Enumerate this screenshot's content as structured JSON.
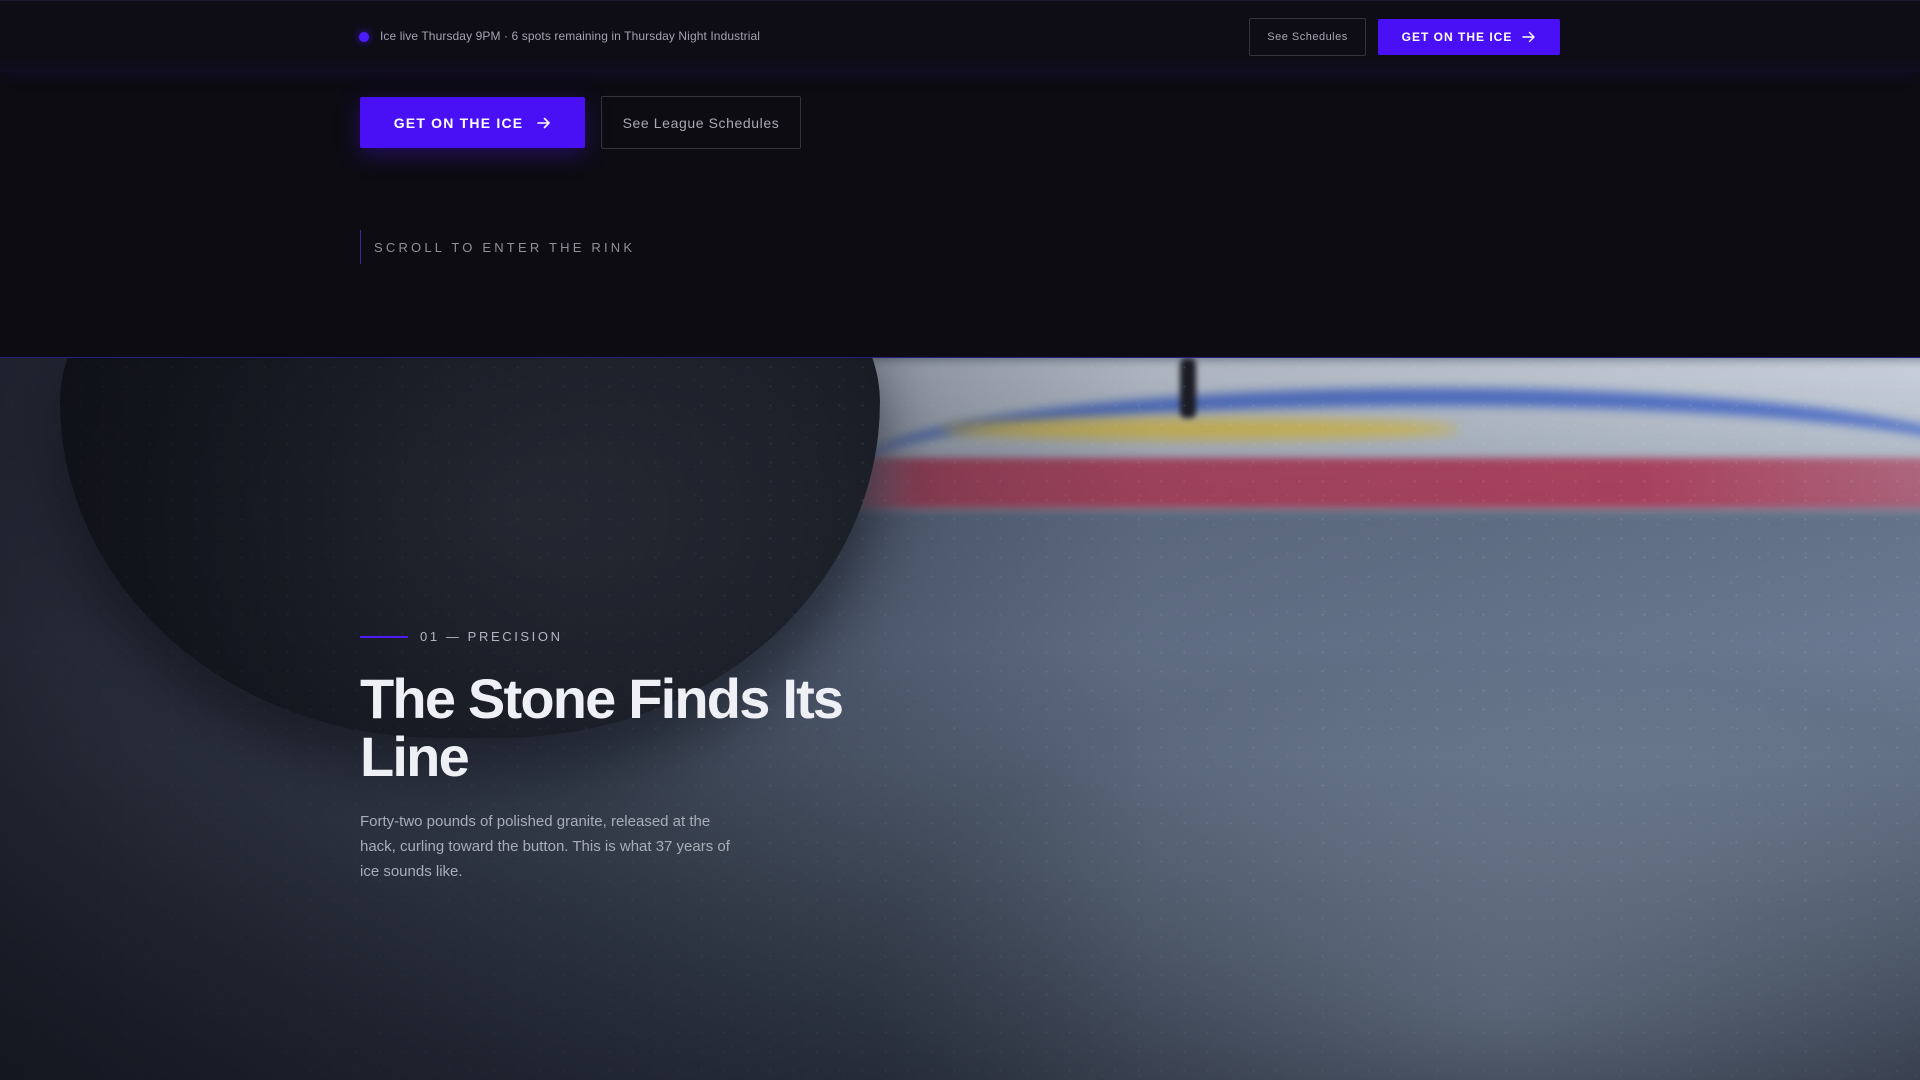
{
  "topbar": {
    "status_text": "Ice live Thursday 9PM · 6 spots remaining in Thursday Night Industrial",
    "secondary_label": "See Schedules",
    "primary_label": "GET ON THE ICE"
  },
  "hero": {
    "cta_primary_label": "GET ON THE ICE",
    "cta_secondary_label": "See League Schedules",
    "scroll_cue": "SCROLL TO ENTER THE RINK"
  },
  "section": {
    "label": "01 — PRECISION",
    "headline": "The Stone Finds Its Line",
    "body": "Forty-two pounds of polished granite, released at the hack, curling toward the button. This is what 37 years of ice sounds like."
  },
  "colors": {
    "accent": "#4a10f5",
    "background": "#0d0c12",
    "text_muted": "#a3a3b0"
  },
  "icons": {
    "status": "live-dot-icon",
    "cta": "arrow-right-icon"
  }
}
